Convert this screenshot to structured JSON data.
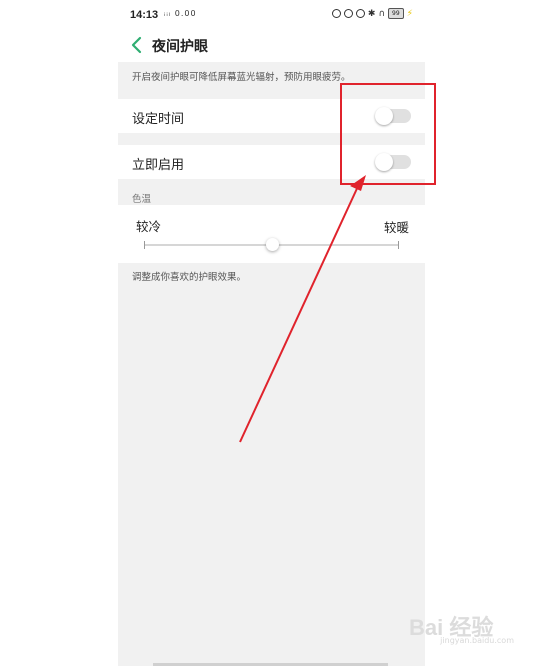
{
  "status_bar": {
    "time": "14:13",
    "signal": "ᵢᵢₗ 0.00",
    "battery": "99"
  },
  "header": {
    "title": "夜间护眼"
  },
  "description": "开启夜间护眼可降低屏幕蓝光辐射，预防用眼疲劳。",
  "settings": [
    {
      "label": "设定时间",
      "enabled": false
    },
    {
      "label": "立即启用",
      "enabled": false
    }
  ],
  "color_temp": {
    "section_label": "色温",
    "cold_label": "较冷",
    "warm_label": "较暖",
    "level": 0.5
  },
  "hint": "调整成你喜欢的护眼效果。",
  "watermark": {
    "text": "Bai 经验",
    "sub": "jingyan.baidu.com"
  },
  "annotation": {
    "color": "#e0232c"
  }
}
